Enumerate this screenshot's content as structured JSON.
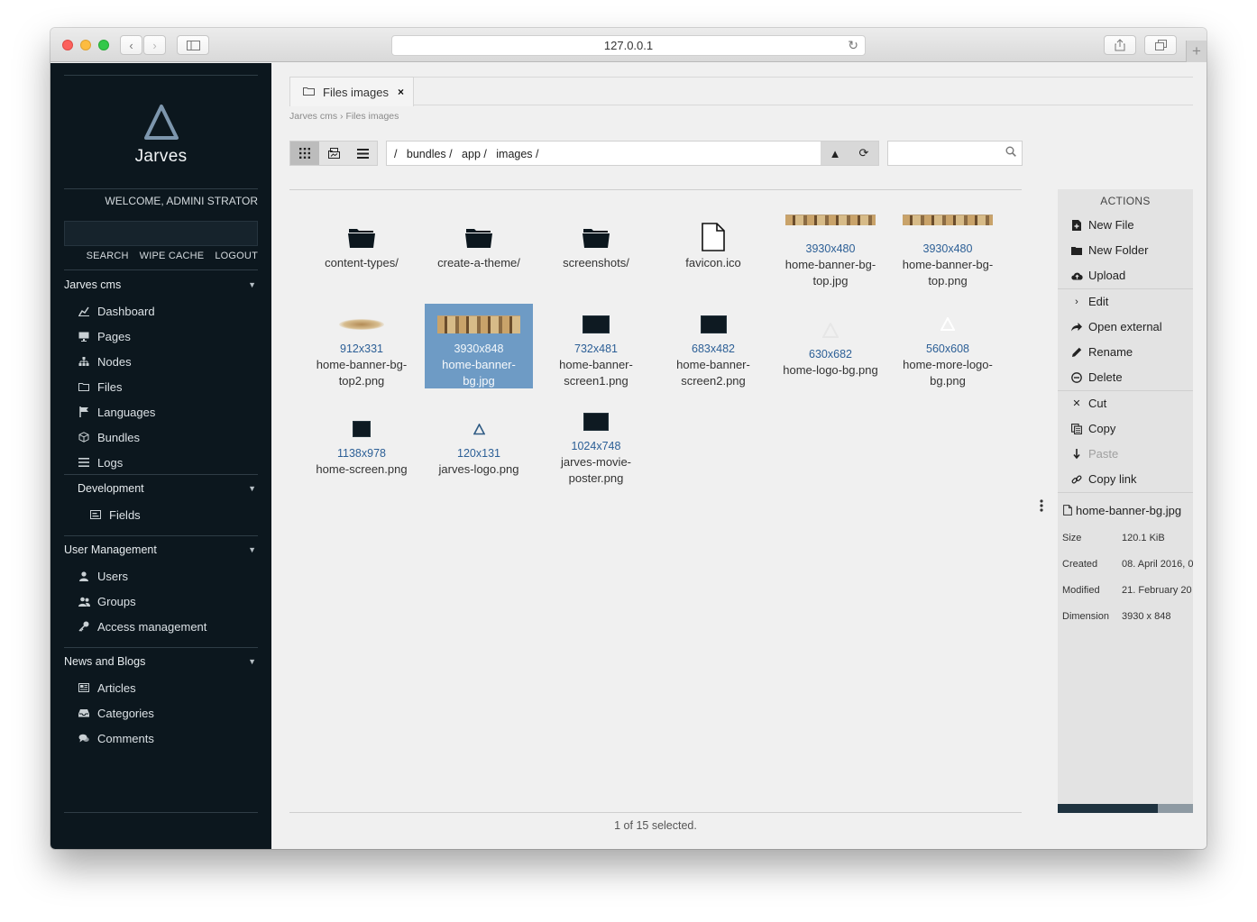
{
  "browser": {
    "url": "127.0.0.1"
  },
  "sidebar": {
    "logo_name": "Jarves",
    "welcome": "WELCOME, ADMINI STRATOR",
    "actions": [
      "SEARCH",
      "WIPE CACHE",
      "LOGOUT"
    ],
    "groups": [
      {
        "title": "Jarves cms",
        "items": [
          {
            "label": "Dashboard",
            "icon": "chart-icon"
          },
          {
            "label": "Pages",
            "icon": "monitor-icon"
          },
          {
            "label": "Nodes",
            "icon": "sitemap-icon"
          },
          {
            "label": "Files",
            "icon": "folder-icon"
          },
          {
            "label": "Languages",
            "icon": "flag-icon"
          },
          {
            "label": "Bundles",
            "icon": "cube-icon"
          },
          {
            "label": "Logs",
            "icon": "list-icon"
          }
        ]
      },
      {
        "title": "Development",
        "items": [
          {
            "label": "Fields",
            "icon": "form-icon"
          }
        ]
      },
      {
        "title": "User Management",
        "items": [
          {
            "label": "Users",
            "icon": "user-icon"
          },
          {
            "label": "Groups",
            "icon": "users-icon"
          },
          {
            "label": "Access management",
            "icon": "key-icon"
          }
        ]
      },
      {
        "title": "News and Blogs",
        "items": [
          {
            "label": "Articles",
            "icon": "newspaper-icon"
          },
          {
            "label": "Categories",
            "icon": "tray-icon"
          },
          {
            "label": "Comments",
            "icon": "comments-icon"
          }
        ]
      }
    ]
  },
  "tab": {
    "label": "Files images",
    "close": "×"
  },
  "breadcrumb": [
    "Jarves cms",
    "›",
    "Files images"
  ],
  "pathbar": {
    "path": "/   bundles /   app /   images /"
  },
  "files": [
    {
      "name": "content-types/",
      "type": "folder"
    },
    {
      "name": "create-a-theme/",
      "type": "folder"
    },
    {
      "name": "screenshots/",
      "type": "folder"
    },
    {
      "name": "favicon.ico",
      "type": "file"
    },
    {
      "name": "home-banner-bg-top.jpg",
      "dim": "3930x480",
      "type": "banner"
    },
    {
      "name": "home-banner-bg-top.png",
      "dim": "3930x480",
      "type": "banner"
    },
    {
      "name": "home-banner-bg-top2.png",
      "dim": "912x331",
      "type": "blurry"
    },
    {
      "name": "home-banner-bg.jpg",
      "dim": "3930x848",
      "type": "banner",
      "selected": true
    },
    {
      "name": "home-banner-screen1.png",
      "dim": "732x481",
      "type": "dark"
    },
    {
      "name": "home-banner-screen2.png",
      "dim": "683x482",
      "type": "dark"
    },
    {
      "name": "home-logo-bg.png",
      "dim": "630x682",
      "type": "logo-faint"
    },
    {
      "name": "home-more-logo-bg.png",
      "dim": "560x608",
      "type": "logo-faint"
    },
    {
      "name": "home-screen.png",
      "dim": "1138x978",
      "type": "dark"
    },
    {
      "name": "jarves-logo.png",
      "dim": "120x131",
      "type": "logo"
    },
    {
      "name": "jarves-movie-poster.png",
      "dim": "1024x748",
      "type": "dark"
    }
  ],
  "status": "1 of 15 selected.",
  "actions_panel": {
    "title": "ACTIONS",
    "items": [
      {
        "label": "New File",
        "icon": "new-file-icon"
      },
      {
        "label": "New Folder",
        "icon": "new-folder-icon"
      },
      {
        "label": "Upload",
        "icon": "upload-icon"
      },
      {
        "label": "Edit",
        "icon": "chevron-right-icon"
      },
      {
        "label": "Open external",
        "icon": "share-icon"
      },
      {
        "label": "Rename",
        "icon": "pencil-icon"
      },
      {
        "label": "Delete",
        "icon": "minus-circle-icon"
      },
      {
        "label": "Cut",
        "icon": "scissors-icon"
      },
      {
        "label": "Copy",
        "icon": "copy-icon"
      },
      {
        "label": "Paste",
        "icon": "paste-icon",
        "disabled": true
      },
      {
        "label": "Copy link",
        "icon": "link-icon"
      }
    ],
    "selected_file": "home-banner-bg.jpg",
    "props": [
      {
        "key": "Size",
        "value": "120.1 KiB"
      },
      {
        "key": "Created",
        "value": "08. April 2016, 0"
      },
      {
        "key": "Modified",
        "value": "21. February 20"
      },
      {
        "key": "Dimension",
        "value": "3930 x 848"
      }
    ],
    "scroll_progress": 0.74
  }
}
